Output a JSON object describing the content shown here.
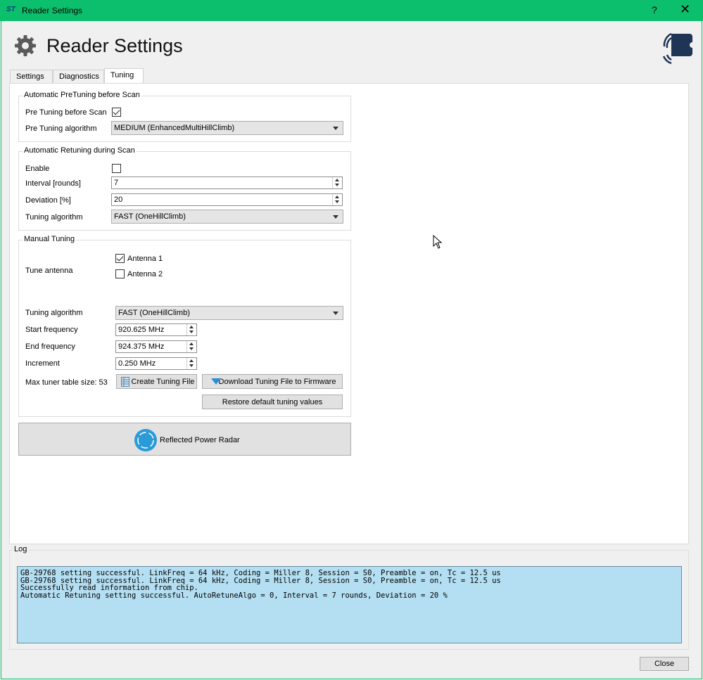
{
  "window": {
    "title": "Reader Settings",
    "app_icon_text": "ST",
    "help_label": "?",
    "close_label": "✕"
  },
  "header": {
    "title": "Reader Settings"
  },
  "tabs": [
    {
      "label": "Settings",
      "active": false
    },
    {
      "label": "Diagnostics",
      "active": false
    },
    {
      "label": "Tuning",
      "active": true
    }
  ],
  "pretuning": {
    "group_title": "Automatic PreTuning before Scan",
    "enable_label": "Pre Tuning before Scan",
    "enabled": true,
    "algorithm_label": "Pre Tuning algorithm",
    "algorithm_value": "MEDIUM (EnhancedMultiHillClimb)"
  },
  "retuning": {
    "group_title": "Automatic Retuning during Scan",
    "enable_label": "Enable",
    "enabled": false,
    "interval_label": "Interval [rounds]",
    "interval_value": "7",
    "deviation_label": "Deviation [%]",
    "deviation_value": "20",
    "algorithm_label": "Tuning algorithm",
    "algorithm_value": "FAST (OneHillClimb)"
  },
  "manual": {
    "group_title": "Manual Tuning",
    "tune_antenna_label": "Tune antenna",
    "antenna1_label": "Antenna 1",
    "antenna1_checked": true,
    "antenna2_label": "Antenna 2",
    "antenna2_checked": false,
    "algorithm_label": "Tuning algorithm",
    "algorithm_value": "FAST (OneHillClimb)",
    "start_label": "Start frequency",
    "start_value": "920.625 MHz",
    "end_label": "End frequency",
    "end_value": "924.375 MHz",
    "increment_label": "Increment",
    "increment_value": "0.250 MHz",
    "max_table_label": "Max tuner table size: 53",
    "create_button": "Create Tuning File",
    "download_button": "Download Tuning File to Firmware",
    "restore_button": "Restore default tuning values"
  },
  "radar_button": "Reflected Power Radar",
  "log": {
    "group_title": "Log",
    "lines": "GB-29768 setting successful. LinkFreq = 64 kHz, Coding = Miller 8, Session = S0, Preamble = on, Tc = 12.5 us\nGB-29768 setting successful. LinkFreq = 64 kHz, Coding = Miller 8, Session = S0, Preamble = on, Tc = 12.5 us\nSuccessfully read information from chip.\nAutomatic Retuning setting successful. AutoRetuneAlgo = 0, Interval = 7 rounds, Deviation = 20 %"
  },
  "close_button": "Close",
  "colors": {
    "titlebar": "#0cbf6d",
    "log_background": "#b4dff2",
    "radar_icon": "#2a9bd6"
  }
}
